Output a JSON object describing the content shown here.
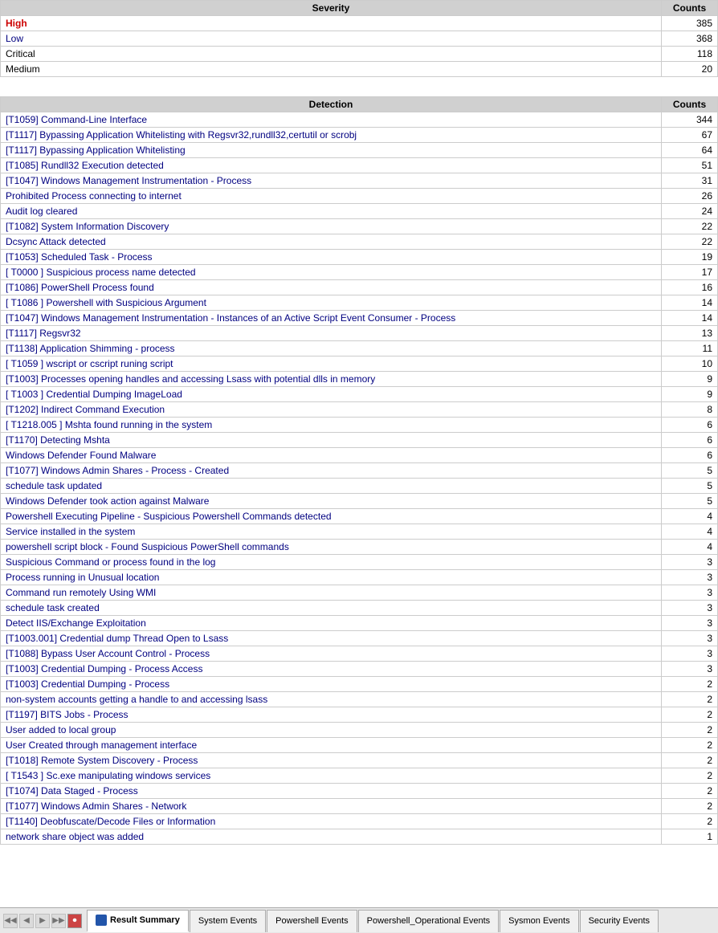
{
  "severity_table": {
    "headers": [
      "Severity",
      "Counts"
    ],
    "rows": [
      {
        "name": "High",
        "count": 385,
        "style": "high"
      },
      {
        "name": "Low",
        "count": 368,
        "style": "low"
      },
      {
        "name": "Critical",
        "count": 118,
        "style": "critical"
      },
      {
        "name": "Medium",
        "count": 20,
        "style": "medium"
      }
    ]
  },
  "detection_table": {
    "headers": [
      "Detection",
      "Counts"
    ],
    "rows": [
      {
        "name": "[T1059] Command-Line Interface",
        "count": 344
      },
      {
        "name": "[T1117] Bypassing Application Whitelisting with Regsvr32,rundll32,certutil or scrobj",
        "count": 67
      },
      {
        "name": "[T1117] Bypassing Application Whitelisting",
        "count": 64
      },
      {
        "name": "[T1085] Rundll32 Execution detected",
        "count": 51
      },
      {
        "name": "[T1047] Windows Management Instrumentation - Process",
        "count": 31
      },
      {
        "name": "Prohibited Process connecting to internet",
        "count": 26
      },
      {
        "name": "Audit log cleared",
        "count": 24
      },
      {
        "name": "[T1082] System Information Discovery",
        "count": 22
      },
      {
        "name": "Dcsync Attack detected",
        "count": 22
      },
      {
        "name": "[T1053] Scheduled Task - Process",
        "count": 19
      },
      {
        "name": "[ T0000 ] Suspicious process name detected",
        "count": 17
      },
      {
        "name": "[T1086] PowerShell Process found",
        "count": 16
      },
      {
        "name": "[ T1086 ]  Powershell with Suspicious Argument",
        "count": 14
      },
      {
        "name": "[T1047] Windows Management Instrumentation - Instances of an Active Script Event Consumer - Process",
        "count": 14
      },
      {
        "name": "[T1117] Regsvr32",
        "count": 13
      },
      {
        "name": "[T1138] Application Shimming - process",
        "count": 11
      },
      {
        "name": "[ T1059 ] wscript or cscript runing script",
        "count": 10
      },
      {
        "name": "[T1003] Processes opening handles and accessing Lsass with potential dlls in memory",
        "count": 9
      },
      {
        "name": "[  T1003 ] Credential Dumping ImageLoad",
        "count": 9
      },
      {
        "name": "[T1202] Indirect Command Execution",
        "count": 8
      },
      {
        "name": "[ T1218.005 ] Mshta found running in the system",
        "count": 6
      },
      {
        "name": "[T1170] Detecting  Mshta",
        "count": 6
      },
      {
        "name": "Windows Defender Found Malware",
        "count": 6
      },
      {
        "name": "[T1077] Windows Admin Shares - Process - Created",
        "count": 5
      },
      {
        "name": "schedule task updated",
        "count": 5
      },
      {
        "name": "Windows Defender took action against Malware",
        "count": 5
      },
      {
        "name": "Powershell Executing Pipeline - Suspicious Powershell Commands detected",
        "count": 4
      },
      {
        "name": "Service installed in the system",
        "count": 4
      },
      {
        "name": "powershell script block - Found Suspicious PowerShell commands",
        "count": 4
      },
      {
        "name": "Suspicious Command or process found in the log",
        "count": 3
      },
      {
        "name": "Process running in Unusual location",
        "count": 3
      },
      {
        "name": "Command run remotely Using WMI",
        "count": 3
      },
      {
        "name": "schedule task created",
        "count": 3
      },
      {
        "name": "Detect IIS/Exchange Exploitation",
        "count": 3
      },
      {
        "name": "[T1003.001] Credential dump Thread Open to Lsass",
        "count": 3
      },
      {
        "name": "[T1088] Bypass User Account Control - Process",
        "count": 3
      },
      {
        "name": "[T1003] Credential Dumping - Process Access",
        "count": 3
      },
      {
        "name": "[T1003] Credential Dumping - Process",
        "count": 2
      },
      {
        "name": "non-system accounts getting a handle to and accessing lsass",
        "count": 2
      },
      {
        "name": "[T1197] BITS Jobs - Process",
        "count": 2
      },
      {
        "name": "User added to local group",
        "count": 2
      },
      {
        "name": "User Created through management interface",
        "count": 2
      },
      {
        "name": "[T1018] Remote System Discovery - Process",
        "count": 2
      },
      {
        "name": "[  T1543 ] Sc.exe manipulating windows services",
        "count": 2
      },
      {
        "name": "[T1074] Data Staged - Process",
        "count": 2
      },
      {
        "name": "[T1077] Windows Admin Shares - Network",
        "count": 2
      },
      {
        "name": "[T1140] Deobfuscate/Decode Files or Information",
        "count": 2
      },
      {
        "name": "network share object was added",
        "count": 1
      }
    ]
  },
  "tabs": [
    {
      "label": "Result Summary",
      "active": true,
      "has_icon": true
    },
    {
      "label": "System Events",
      "active": false,
      "has_icon": false
    },
    {
      "label": "Powershell Events",
      "active": false,
      "has_icon": false
    },
    {
      "label": "Powershell_Operational Events",
      "active": false,
      "has_icon": false
    },
    {
      "label": "Sysmon Events",
      "active": false,
      "has_icon": false
    },
    {
      "label": "Security Events",
      "active": false,
      "has_icon": false
    }
  ],
  "nav_buttons": [
    "◀◀",
    "◀",
    "▶",
    "▶▶",
    "⏺"
  ]
}
